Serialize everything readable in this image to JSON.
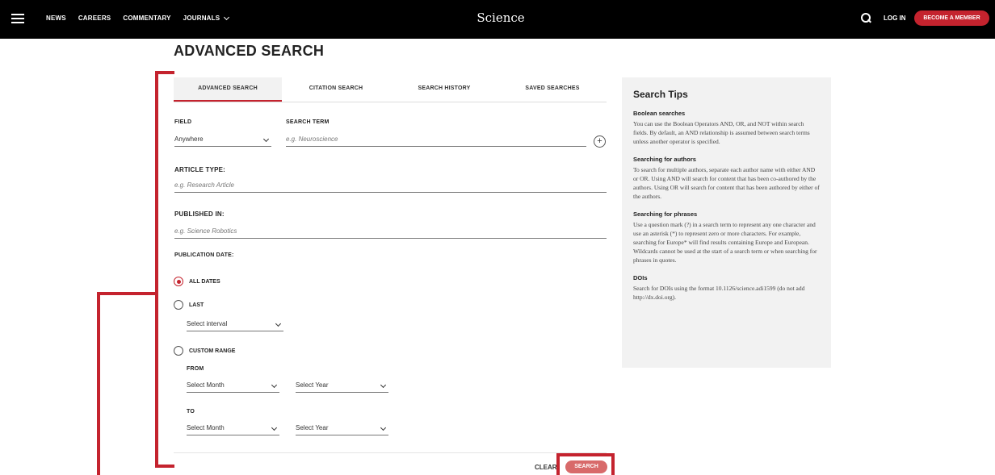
{
  "nav": {
    "items": [
      "NEWS",
      "CAREERS",
      "COMMENTARY",
      "JOURNALS"
    ],
    "brand": "Science",
    "login": "LOG IN",
    "member": "BECOME A MEMBER"
  },
  "page_title": "ADVANCED SEARCH",
  "tabs": [
    "ADVANCED SEARCH",
    "CITATION SEARCH",
    "SEARCH HISTORY",
    "SAVED SEARCHES"
  ],
  "form": {
    "field_label": "FIELD",
    "field_value": "Anywhere",
    "term_label": "SEARCH TERM",
    "term_placeholder": "e.g. Neuroscience",
    "article_label": "ARTICLE TYPE:",
    "article_placeholder": "e.g. Research Article",
    "published_label": "PUBLISHED IN:",
    "published_placeholder": "e.g. Science Robotics",
    "date_label": "PUBLICATION DATE:",
    "all_dates": "ALL DATES",
    "last": "LAST",
    "interval": "Select interval",
    "custom": "CUSTOM RANGE",
    "from": "FROM",
    "to": "TO",
    "month": "Select Month",
    "year": "Select Year",
    "clear": "CLEAR",
    "search": "SEARCH"
  },
  "tips": {
    "title": "Search Tips",
    "sections": [
      {
        "h": "Boolean searches",
        "p": "You can use the Boolean Operators AND, OR, and NOT within search fields. By default, an AND relationship is assumed between search terms unless another operator is specified."
      },
      {
        "h": "Searching for authors",
        "p": "To search for multiple authors, separate each author name with either AND or OR. Using AND will search for content that has been co-authored by the authors. Using OR will search for content that has been authored by either of the authors."
      },
      {
        "h": "Searching for phrases",
        "p": "Use a question mark (?) in a search term to represent any one character and use an asterisk (*) to represent zero or more characters. For example, searching for Europe* will find results containing Europe and European. Wildcards cannot be used at the start of a search term or when searching for phrases in quotes."
      },
      {
        "h": "DOIs",
        "p": "Search for DOIs using the format 10.1126/science.adi1599 (do not add http://dx.doi.org)."
      }
    ]
  },
  "colors": {
    "brand_red": "#c4232e",
    "topbar": "#000000"
  }
}
